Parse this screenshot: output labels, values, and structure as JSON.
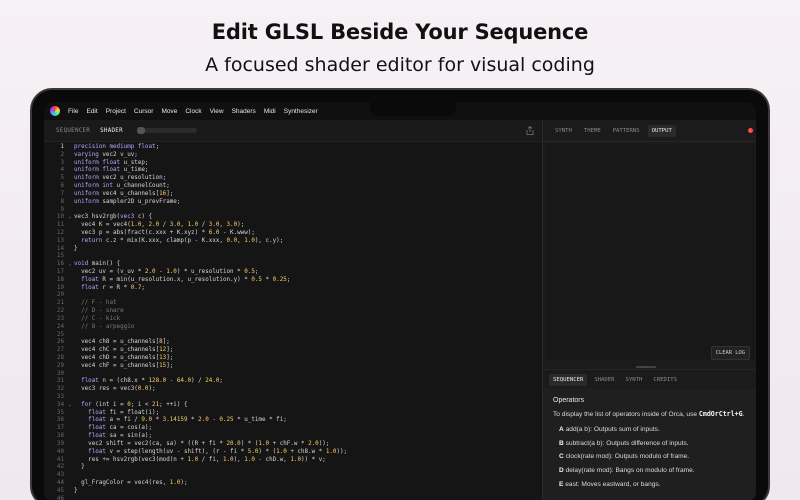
{
  "headline": "Edit GLSL Beside Your Sequence",
  "subheadline": "A focused shader editor for visual coding",
  "menu": [
    "File",
    "Edit",
    "Project",
    "Cursor",
    "Move",
    "Clock",
    "View",
    "Shaders",
    "Midi",
    "Synthesizer"
  ],
  "editor_tabs": [
    "SEQUENCER",
    "SHADER"
  ],
  "code_lines": [
    [
      {
        "t": "precision mediump ",
        "c": "kw"
      },
      {
        "t": "float",
        "c": "kw"
      },
      {
        "t": ";"
      }
    ],
    [
      {
        "t": "varying ",
        "c": "kw"
      },
      {
        "t": "vec2 v_uv;"
      }
    ],
    [
      {
        "t": "uniform ",
        "c": "kw"
      },
      {
        "t": "float",
        "c": "kw"
      },
      {
        "t": " u_step;"
      }
    ],
    [
      {
        "t": "uniform ",
        "c": "kw"
      },
      {
        "t": "float",
        "c": "kw"
      },
      {
        "t": " u_time;"
      }
    ],
    [
      {
        "t": "uniform ",
        "c": "kw"
      },
      {
        "t": "vec2 u_resolution;"
      }
    ],
    [
      {
        "t": "uniform ",
        "c": "kw"
      },
      {
        "t": "int",
        "c": "kw"
      },
      {
        "t": " u_channelCount;"
      }
    ],
    [
      {
        "t": "uniform ",
        "c": "kw"
      },
      {
        "t": "vec4 u_channels["
      },
      {
        "t": "16",
        "c": "num"
      },
      {
        "t": "];"
      }
    ],
    [
      {
        "t": "uniform ",
        "c": "kw"
      },
      {
        "t": "sampler2D u_prevFrame;"
      }
    ],
    [],
    [
      {
        "t": "vec3 hsv2rgb("
      },
      {
        "t": "vec3",
        "c": "kw"
      },
      {
        "t": " c) {"
      }
    ],
    [
      {
        "t": "  vec4 K = vec4("
      },
      {
        "t": "1.0",
        "c": "num"
      },
      {
        "t": ", "
      },
      {
        "t": "2.0",
        "c": "num"
      },
      {
        "t": " / "
      },
      {
        "t": "3.0",
        "c": "num"
      },
      {
        "t": ", "
      },
      {
        "t": "1.0",
        "c": "num"
      },
      {
        "t": " / "
      },
      {
        "t": "3.0",
        "c": "num"
      },
      {
        "t": ", "
      },
      {
        "t": "3.0",
        "c": "num"
      },
      {
        "t": ");"
      }
    ],
    [
      {
        "t": "  vec3 p = abs(fract(c.xxx + K.xyz) * "
      },
      {
        "t": "6.0",
        "c": "num"
      },
      {
        "t": " - K.www);"
      }
    ],
    [
      {
        "t": "  return ",
        "c": "kw"
      },
      {
        "t": "c.z * mix(K.xxx, clamp(p - K.xxx, "
      },
      {
        "t": "0.0",
        "c": "num"
      },
      {
        "t": ", "
      },
      {
        "t": "1.0",
        "c": "num"
      },
      {
        "t": "), c.y);"
      }
    ],
    [
      {
        "t": "}"
      }
    ],
    [],
    [
      {
        "t": "void ",
        "c": "kw"
      },
      {
        "t": "main() {"
      }
    ],
    [
      {
        "t": "  vec2 uv = (v_uv * "
      },
      {
        "t": "2.0",
        "c": "num"
      },
      {
        "t": " - "
      },
      {
        "t": "1.0",
        "c": "num"
      },
      {
        "t": ") * u_resolution * "
      },
      {
        "t": "0.5",
        "c": "num"
      },
      {
        "t": ";"
      }
    ],
    [
      {
        "t": "  float ",
        "c": "kw"
      },
      {
        "t": "R = min(u_resolution.x, u_resolution.y) * "
      },
      {
        "t": "0.5",
        "c": "num"
      },
      {
        "t": " * "
      },
      {
        "t": "0.25",
        "c": "num"
      },
      {
        "t": ";"
      }
    ],
    [
      {
        "t": "  float ",
        "c": "kw"
      },
      {
        "t": "r = R * "
      },
      {
        "t": "0.7",
        "c": "num"
      },
      {
        "t": ";"
      }
    ],
    [],
    [
      {
        "t": "  // F - hat",
        "c": "cm"
      }
    ],
    [
      {
        "t": "  // D - snare",
        "c": "cm"
      }
    ],
    [
      {
        "t": "  // C - kick",
        "c": "cm"
      }
    ],
    [
      {
        "t": "  // 8 - arpeggio",
        "c": "cm"
      }
    ],
    [],
    [
      {
        "t": "  vec4 ch8 = u_channels["
      },
      {
        "t": "8",
        "c": "num"
      },
      {
        "t": "];"
      }
    ],
    [
      {
        "t": "  vec4 chC = u_channels["
      },
      {
        "t": "12",
        "c": "num"
      },
      {
        "t": "];"
      }
    ],
    [
      {
        "t": "  vec4 chD = u_channels["
      },
      {
        "t": "13",
        "c": "num"
      },
      {
        "t": "];"
      }
    ],
    [
      {
        "t": "  vec4 chF = u_channels["
      },
      {
        "t": "15",
        "c": "num"
      },
      {
        "t": "];"
      }
    ],
    [],
    [
      {
        "t": "  float ",
        "c": "kw"
      },
      {
        "t": "n = (ch8.x * "
      },
      {
        "t": "128.0",
        "c": "num"
      },
      {
        "t": " - "
      },
      {
        "t": "64.0",
        "c": "num"
      },
      {
        "t": ") / "
      },
      {
        "t": "24.0",
        "c": "num"
      },
      {
        "t": ";"
      }
    ],
    [
      {
        "t": "  vec3 res = vec3("
      },
      {
        "t": "0.0",
        "c": "num"
      },
      {
        "t": ");"
      }
    ],
    [],
    [
      {
        "t": "  for ",
        "c": "kw"
      },
      {
        "t": "(int i = "
      },
      {
        "t": "0",
        "c": "num"
      },
      {
        "t": "; i < "
      },
      {
        "t": "21",
        "c": "num"
      },
      {
        "t": "; ++i) {"
      }
    ],
    [
      {
        "t": "    float ",
        "c": "kw"
      },
      {
        "t": "fi = float(i);"
      }
    ],
    [
      {
        "t": "    float ",
        "c": "kw"
      },
      {
        "t": "a = fi / "
      },
      {
        "t": "9.0",
        "c": "num"
      },
      {
        "t": " * "
      },
      {
        "t": "3.14159",
        "c": "num"
      },
      {
        "t": " * "
      },
      {
        "t": "2.0",
        "c": "num"
      },
      {
        "t": " - "
      },
      {
        "t": "0.25",
        "c": "num"
      },
      {
        "t": " * u_time * fi;"
      }
    ],
    [
      {
        "t": "    float ",
        "c": "kw"
      },
      {
        "t": "ca = cos(a);"
      }
    ],
    [
      {
        "t": "    float ",
        "c": "kw"
      },
      {
        "t": "sa = sin(a);"
      }
    ],
    [
      {
        "t": "    vec2 shift = vec2(ca, sa) * ((R + fi * "
      },
      {
        "t": "20.0",
        "c": "num"
      },
      {
        "t": ") * ("
      },
      {
        "t": "1.0",
        "c": "num"
      },
      {
        "t": " + chF.w * "
      },
      {
        "t": "2.0",
        "c": "num"
      },
      {
        "t": "));"
      }
    ],
    [
      {
        "t": "    float ",
        "c": "kw"
      },
      {
        "t": "v = step(length(uv - shift), (r - fi * "
      },
      {
        "t": "5.0",
        "c": "num"
      },
      {
        "t": ") * ("
      },
      {
        "t": "1.0",
        "c": "num"
      },
      {
        "t": " + ch8.w * "
      },
      {
        "t": "1.0",
        "c": "num"
      },
      {
        "t": "));"
      }
    ],
    [
      {
        "t": "    res += hsv2rgb(vec3(mod(n + "
      },
      {
        "t": "1.0",
        "c": "num"
      },
      {
        "t": " / fi, "
      },
      {
        "t": "1.0",
        "c": "num"
      },
      {
        "t": "), "
      },
      {
        "t": "1.0",
        "c": "num"
      },
      {
        "t": " - chD.w, "
      },
      {
        "t": "1.0",
        "c": "num"
      },
      {
        "t": ")) * v;"
      }
    ],
    [
      {
        "t": "  }"
      }
    ],
    [],
    [
      {
        "t": "  gl_FragColor = vec4(res, "
      },
      {
        "t": "1.0",
        "c": "num"
      },
      {
        "t": ");"
      }
    ],
    [
      {
        "t": "}"
      }
    ],
    [],
    []
  ],
  "fold_lines": [
    10,
    16,
    34
  ],
  "right_tabs": [
    "SYNTH",
    "THEME",
    "PATTERNS",
    "OUTPUT"
  ],
  "clear_log_label": "CLEAR LOG",
  "bottom_tabs": [
    "SEQUENCER",
    "SHADER",
    "SYNTH",
    "CREDITS"
  ],
  "doc": {
    "heading": "Operators",
    "intro": "To display the list of operators inside of Orca, use",
    "shortcut": "CmdOrCtrl+G",
    "intro_end": ".",
    "operators": [
      {
        "key": "A",
        "text": "add(a b): Outputs sum of inputs."
      },
      {
        "key": "B",
        "text": "subtract(a b): Outputs difference of inputs."
      },
      {
        "key": "C",
        "text": "clock(rate mod): Outputs modulo of frame."
      },
      {
        "key": "D",
        "text": "delay(rate mod): Bangs on modulo of frame."
      },
      {
        "key": "E",
        "text": "east: Moves eastward, or bangs."
      }
    ]
  },
  "colors": {
    "keyword": "#b9a3ff",
    "number": "#ffce6b",
    "comment": "#7a7a7a",
    "record": "#ff4d4d"
  }
}
